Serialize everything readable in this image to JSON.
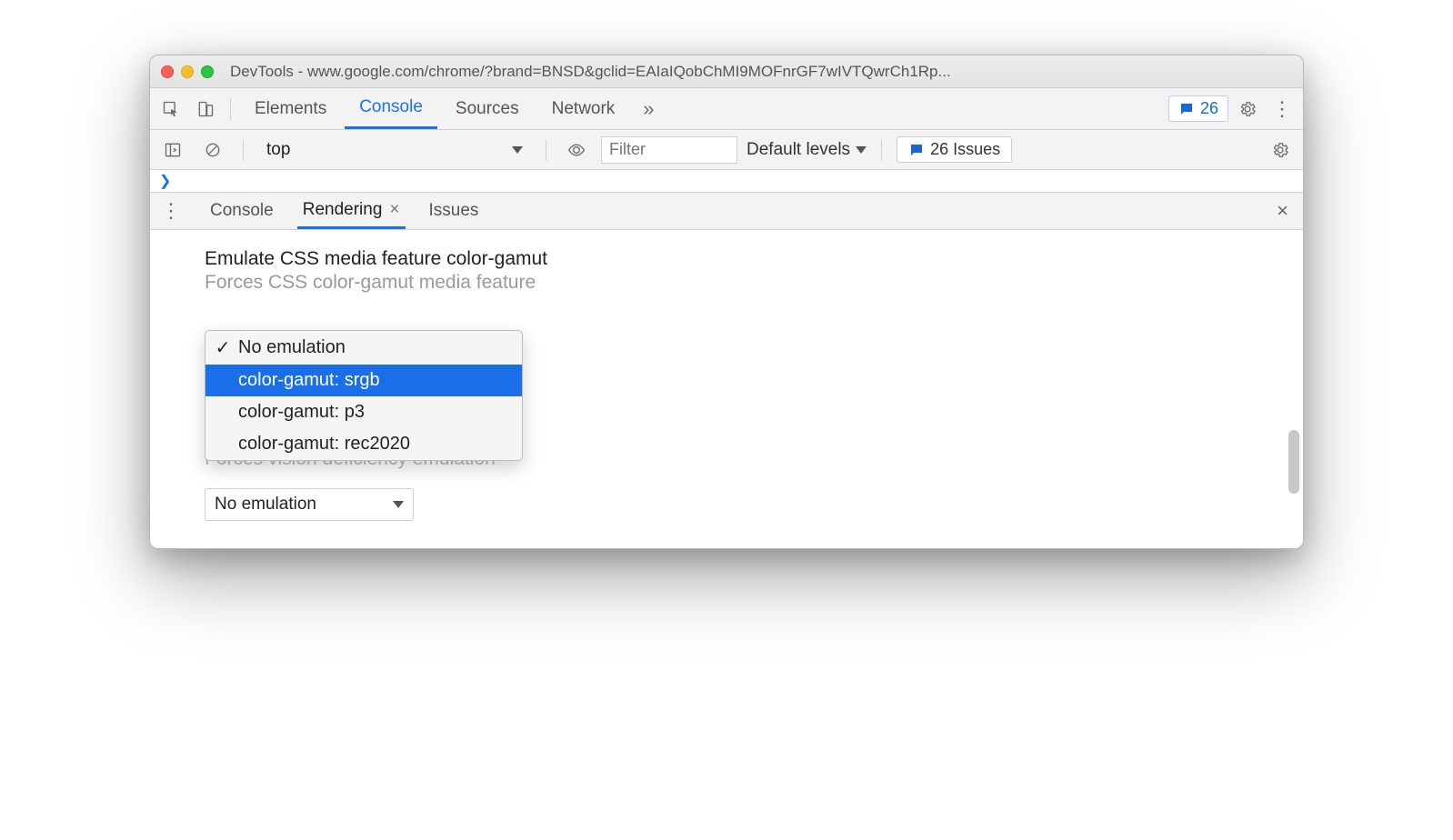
{
  "window_title": "DevTools - www.google.com/chrome/?brand=BNSD&gclid=EAIaIQobChMI9MOFnrGF7wIVTQwrCh1Rp...",
  "main_tabs": {
    "elements": "Elements",
    "console": "Console",
    "sources": "Sources",
    "network": "Network"
  },
  "issues_count": "26",
  "console_toolbar": {
    "context": "top",
    "filter_placeholder": "Filter",
    "levels": "Default levels",
    "issues_label": "26 Issues"
  },
  "drawer_tabs": {
    "console": "Console",
    "rendering": "Rendering",
    "issues": "Issues"
  },
  "rendering": {
    "section_title": "Emulate CSS media feature color-gamut",
    "section_desc": "Forces CSS color-gamut media feature",
    "dropdown": {
      "opt0": "No emulation",
      "opt1": "color-gamut: srgb",
      "opt2": "color-gamut: p3",
      "opt3": "color-gamut: rec2020"
    },
    "obscured_desc": "Forces vision deficiency emulation",
    "closed_select_value": "No emulation"
  }
}
